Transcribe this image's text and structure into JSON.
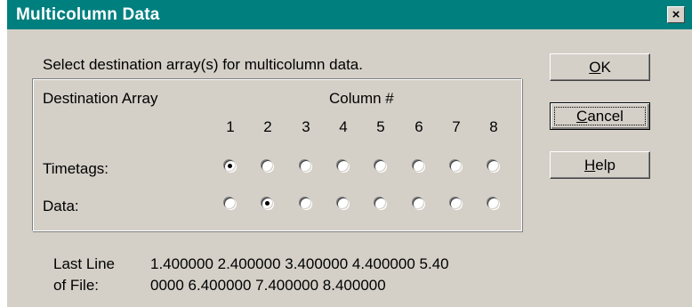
{
  "window": {
    "title": "Multicolumn Data",
    "close_glyph": "×"
  },
  "prompt": "Select destination array(s) for multicolumn data.",
  "group": {
    "header_left": "Destination Array",
    "header_right": "Column #",
    "columns": [
      "1",
      "2",
      "3",
      "4",
      "5",
      "6",
      "7",
      "8"
    ],
    "rows": [
      {
        "label": "Timetags:",
        "selected_column": 1
      },
      {
        "label": "Data:",
        "selected_column": 2
      }
    ]
  },
  "buttons": {
    "ok": {
      "label": "OK",
      "mnemonic": "O"
    },
    "cancel": {
      "label": "Cancel",
      "mnemonic": "C"
    },
    "help": {
      "label": "Help",
      "mnemonic": "H"
    }
  },
  "last_line": {
    "label_line1": "Last Line",
    "label_line2": "of File:",
    "value_line1": "1.400000 2.400000 3.400000 4.400000 5.40",
    "value_line2": "0000 6.400000 7.400000 8.400000"
  },
  "colors": {
    "titlebar": "#007f7f",
    "face": "#d4d0c8"
  }
}
